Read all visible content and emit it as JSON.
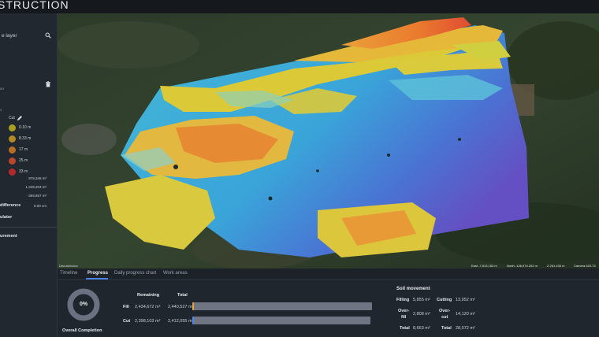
{
  "header": {
    "title": "STRUCTION"
  },
  "sidebar": {
    "layer_title": "e layer",
    "layer_sub": "an",
    "legend_section": "s",
    "mode_label": "Cut",
    "legend": [
      {
        "label": "0.10 m",
        "color": "#a9a021"
      },
      {
        "label": "8.33 m",
        "color": "#b18a23"
      },
      {
        "label": "17 m",
        "color": "#b86d24"
      },
      {
        "label": "25 m",
        "color": "#b9482a"
      },
      {
        "label": "33 m",
        "color": "#b32a2c"
      }
    ],
    "stats": [
      "979,346 m²",
      "1,349,203 m²",
      "-369,857 m²"
    ],
    "difference_label": "difference",
    "difference_value": "0.00 cm",
    "calculator_label": "ulator",
    "measurement_label": "urement"
  },
  "map": {
    "attribution": "Data attribution",
    "status": {
      "east": "East -7,513.153 m",
      "north": "North -126,974.202 m",
      "height": "Z 261.433 m",
      "camera": "Camera 623.73"
    },
    "icons": {
      "search": "search-icon",
      "trash": "trash-icon",
      "edit": "pencil-icon"
    }
  },
  "tabs": [
    {
      "label": "Timeline",
      "active": false
    },
    {
      "label": "Progress",
      "active": true
    },
    {
      "label": "Daily progress chart",
      "active": false
    },
    {
      "label": "Work areas",
      "active": false
    }
  ],
  "progress": {
    "overall_percent": "0%",
    "overall_label": "Overall Completion",
    "col_remaining": "Remaining",
    "col_total": "Total",
    "rows": [
      {
        "label": "Fill",
        "remaining": "2,434,672 m²",
        "total": "2,440,527 m²",
        "fraction": 0.0024,
        "color": "#e7a23a"
      },
      {
        "label": "Cut",
        "remaining": "2,398,103 m²",
        "total": "2,412,055 m²",
        "fraction": 0.0058,
        "color": "#4d86e8"
      }
    ]
  },
  "soil": {
    "title": "Soil movement",
    "filling_label": "Filling",
    "filling_value": "5,855 m²",
    "cutting_label": "Cutting",
    "cutting_value": "13,952 m²",
    "overfill_label": "Over-\nfill",
    "overfill_value": "2,808 m²",
    "overcut_label": "Over-\ncut",
    "overcut_value": "14,120 m²",
    "total_label": "Total",
    "total_fill_value": "8,663 m²",
    "total_cut_value": "28,072 m²"
  },
  "colors": {
    "accent": "#4d86e8",
    "fill_bar": "#e7a23a",
    "panel": "#20262d"
  }
}
